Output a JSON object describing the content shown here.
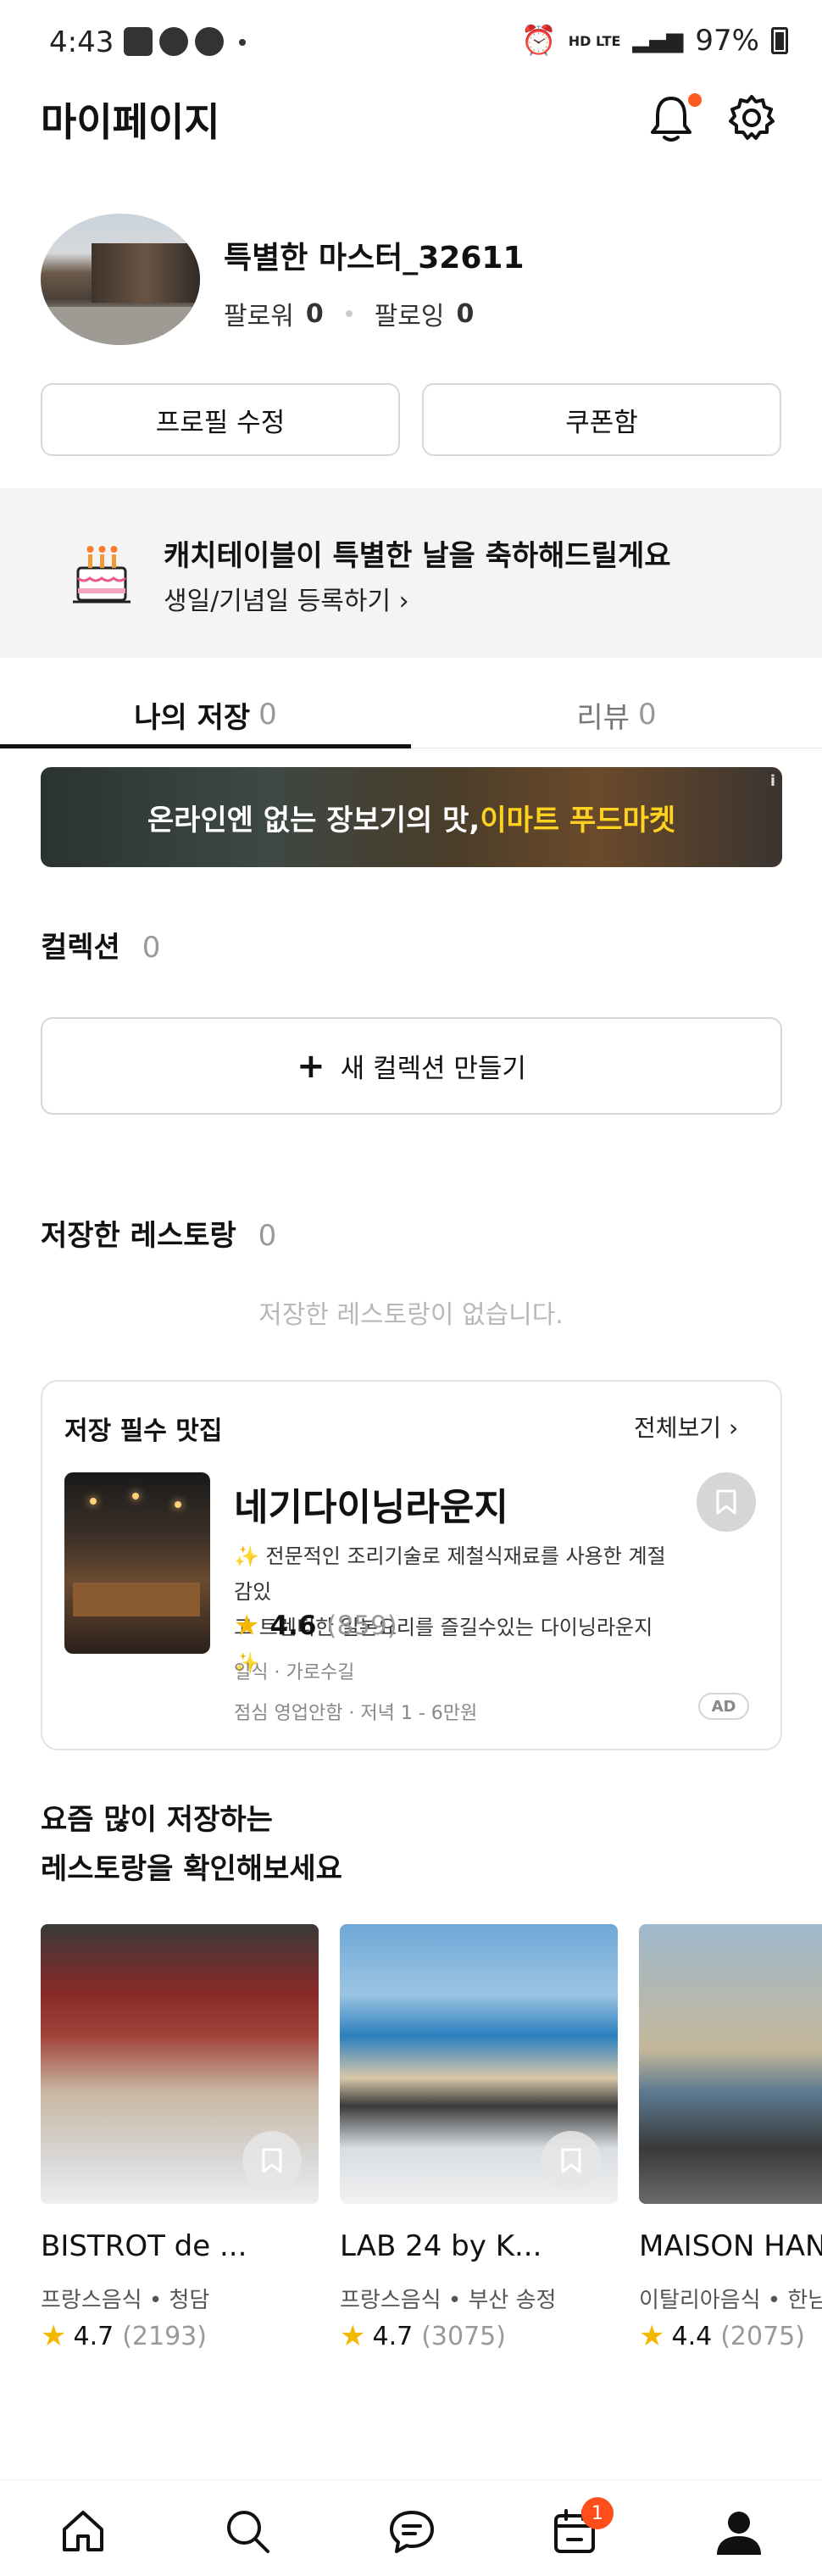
{
  "status_bar": {
    "time": "4:43",
    "right_text": "HD LTE",
    "battery": "97%"
  },
  "header": {
    "title": "마이페이지"
  },
  "profile": {
    "username": "특별한 마스터_32611",
    "followers_label": "팔로워",
    "followers_count": "0",
    "following_label": "팔로잉",
    "following_count": "0",
    "edit_button": "프로필 수정",
    "coupon_button": "쿠폰함"
  },
  "birthday_banner": {
    "title": "캐치테이블이 특별한 날을 축하해드릴게요",
    "link": "생일/기념일 등록하기 ›"
  },
  "tabs": [
    {
      "label": "나의 저장",
      "count": "0",
      "active": true
    },
    {
      "label": "리뷰",
      "count": "0",
      "active": false
    }
  ],
  "ad_banner": {
    "text_part1": "온라인엔 없는 장보기의 맛,",
    "text_part2": "이마트 푸드마켓",
    "info_mark": "i"
  },
  "collection": {
    "title": "컬렉션",
    "count": "0",
    "new_button": "새 컬렉션 만들기",
    "plus": "+"
  },
  "saved_restaurants": {
    "title": "저장한 레스토랑",
    "count": "0",
    "empty_message": "저장한 레스토랑이 없습니다."
  },
  "must_save": {
    "title": "저장 필수 맛집",
    "more": "전체보기 ›",
    "restaurant": {
      "name": "네기다이닝라운지",
      "desc_line1": "✨ 전문적인 조리기술로 제철식재료를 사용한 계절감있",
      "desc_line2": "고 트렌디한 일본요리를 즐길수있는 다이닝라운지 ✨",
      "rating": "4.6",
      "review_count": "(859)",
      "category": "일식 · 가로수길",
      "hours": "점심 영업안함 · 저녁 1 - 6만원",
      "ad_label": "AD"
    }
  },
  "recommend": {
    "title_line1": "요즘 많이 저장하는",
    "title_line2": "레스토랑을 확인해보세요",
    "items": [
      {
        "name": "BISTROT de ...",
        "sub": "프랑스음식 • 청담",
        "rating": "4.7",
        "count": "(2193)"
      },
      {
        "name": "LAB 24 by K...",
        "sub": "프랑스음식 • 부산 송정",
        "rating": "4.7",
        "count": "(3075)"
      },
      {
        "name": "MAISON HAN",
        "sub": "이탈리아음식 • 한남",
        "rating": "4.4",
        "count": "(2075)"
      }
    ]
  },
  "bottom_nav": {
    "items": [
      "home-icon",
      "search-icon",
      "chat-icon",
      "calendar-icon",
      "profile-icon"
    ],
    "calendar_badge": "1"
  },
  "colors": {
    "accent": "#ff4e1a",
    "star": "#f5b800",
    "ad_highlight": "#ffd21f"
  }
}
